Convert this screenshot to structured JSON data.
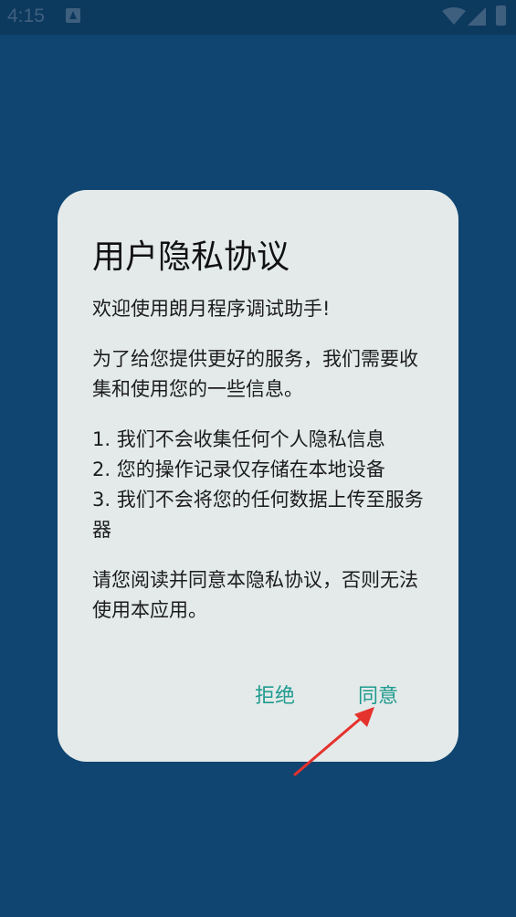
{
  "status_bar": {
    "time": "4:15",
    "icons": [
      "notification-icon",
      "wifi-icon",
      "signal-icon",
      "battery-icon"
    ]
  },
  "dialog": {
    "title": "用户隐私协议",
    "paragraphs": [
      "欢迎使用朗月程序调试助手!",
      "为了给您提供更好的服务，我们需要收集和使用您的一些信息。",
      "1. 我们不会收集任何个人隐私信息",
      "2. 您的操作记录仅存储在本地设备",
      "3. 我们不会将您的任何数据上传至服务器",
      "请您阅读并同意本隐私协议，否则无法使用本应用。"
    ],
    "reject_label": "拒绝",
    "agree_label": "同意"
  },
  "colors": {
    "background": "#0f4570",
    "dialog": "#e4eaea",
    "accent": "#1f9b8f",
    "annotation_arrow": "#e5322d"
  }
}
